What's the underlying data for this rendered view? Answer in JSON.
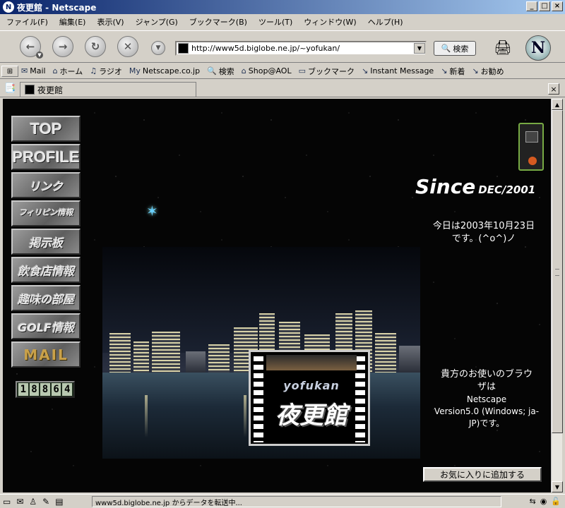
{
  "window": {
    "title": "夜更館 - Netscape",
    "buttons": {
      "minimize": "_",
      "maximize": "□",
      "close": "×"
    }
  },
  "menu": [
    "ファイル(F)",
    "編集(E)",
    "表示(V)",
    "ジャンプ(G)",
    "ブックマーク(B)",
    "ツール(T)",
    "ウィンドウ(W)",
    "ヘルプ(H)"
  ],
  "nav": {
    "url": "http://www5d.biglobe.ne.jp/~yofukan/",
    "search_label": "検索"
  },
  "personal_bar": {
    "items": [
      "Mail",
      "ホーム",
      "ラジオ",
      "Netscape.co.jp",
      "検索",
      "Shop@AOL",
      "ブックマーク",
      "Instant Message",
      "新着",
      "お勧め"
    ]
  },
  "tab": {
    "title": "夜更館"
  },
  "page": {
    "menu_buttons": [
      "TOP",
      "PROFILE",
      "リンク",
      "フィリピン情報",
      "掲示板",
      "飲食店情報",
      "趣味の部屋",
      "GOLF情報",
      "MAIL"
    ],
    "counter": [
      "1",
      "8",
      "8",
      "6",
      "4"
    ],
    "since_big": "Since",
    "since_small": "DEC/2001",
    "today_line1": "今日は2003年10月23日",
    "today_line2": "です。(^o^)ノ",
    "logo_en": "yofukan",
    "logo_jp": "夜更館",
    "browser_line1": "貴方のお使いのブラウ",
    "browser_line2": "ザは",
    "browser_line3": "Netscape",
    "browser_line4": "Version5.0 (Windows; ja-",
    "browser_line5": "JP)です。",
    "favorite_button": "お気に入りに追加する"
  },
  "status": {
    "text": "www5d.biglobe.ne.jp からデータを転送中..."
  },
  "colors": {
    "titlebar": "#0a246a",
    "chrome": "#d4d0c8",
    "page_bg": "#050505"
  }
}
